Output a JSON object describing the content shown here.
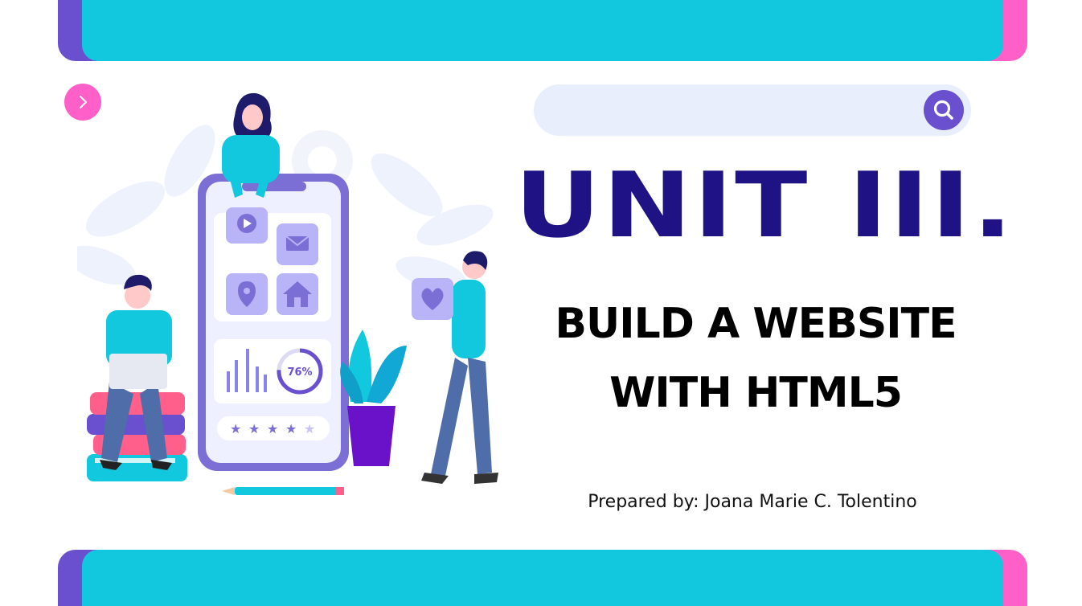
{
  "slide": {
    "title": "UNIT III.",
    "subtitle_line1": "BUILD A WEBSITE",
    "subtitle_line2": "WITH HTML5",
    "prepared_by": "Prepared by: Joana Marie C. Tolentino"
  },
  "search": {
    "placeholder": "",
    "value": ""
  },
  "illustration": {
    "progress_label": "76%",
    "progress_value": 76,
    "rating_stars_filled": 4,
    "rating_stars_total": 5
  },
  "colors": {
    "cyan": "#12c8de",
    "purple": "#6a4fcf",
    "pink": "#ff5fc8",
    "navy": "#1f1284",
    "search_bg": "#e8eefc"
  },
  "icons": {
    "next": "chevron-right-icon",
    "search": "magnifier-icon"
  }
}
